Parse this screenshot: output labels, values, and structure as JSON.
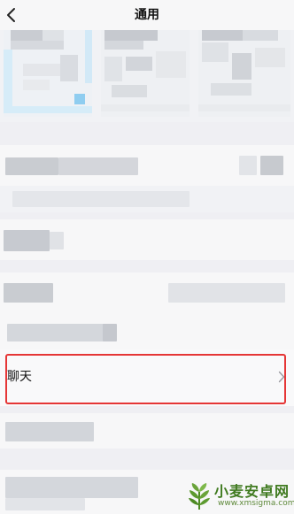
{
  "nav": {
    "title": "通用",
    "back_icon": "chevron-left-icon"
  },
  "settings": {
    "chat_row": {
      "label": "聊天",
      "chevron_icon": "chevron-right-icon"
    }
  },
  "highlight": {
    "color": "#e53636"
  },
  "watermark": {
    "title": "小麦安卓网",
    "url": "www.xmsigma.com",
    "logo_icon": "wheat-logo-icon"
  }
}
